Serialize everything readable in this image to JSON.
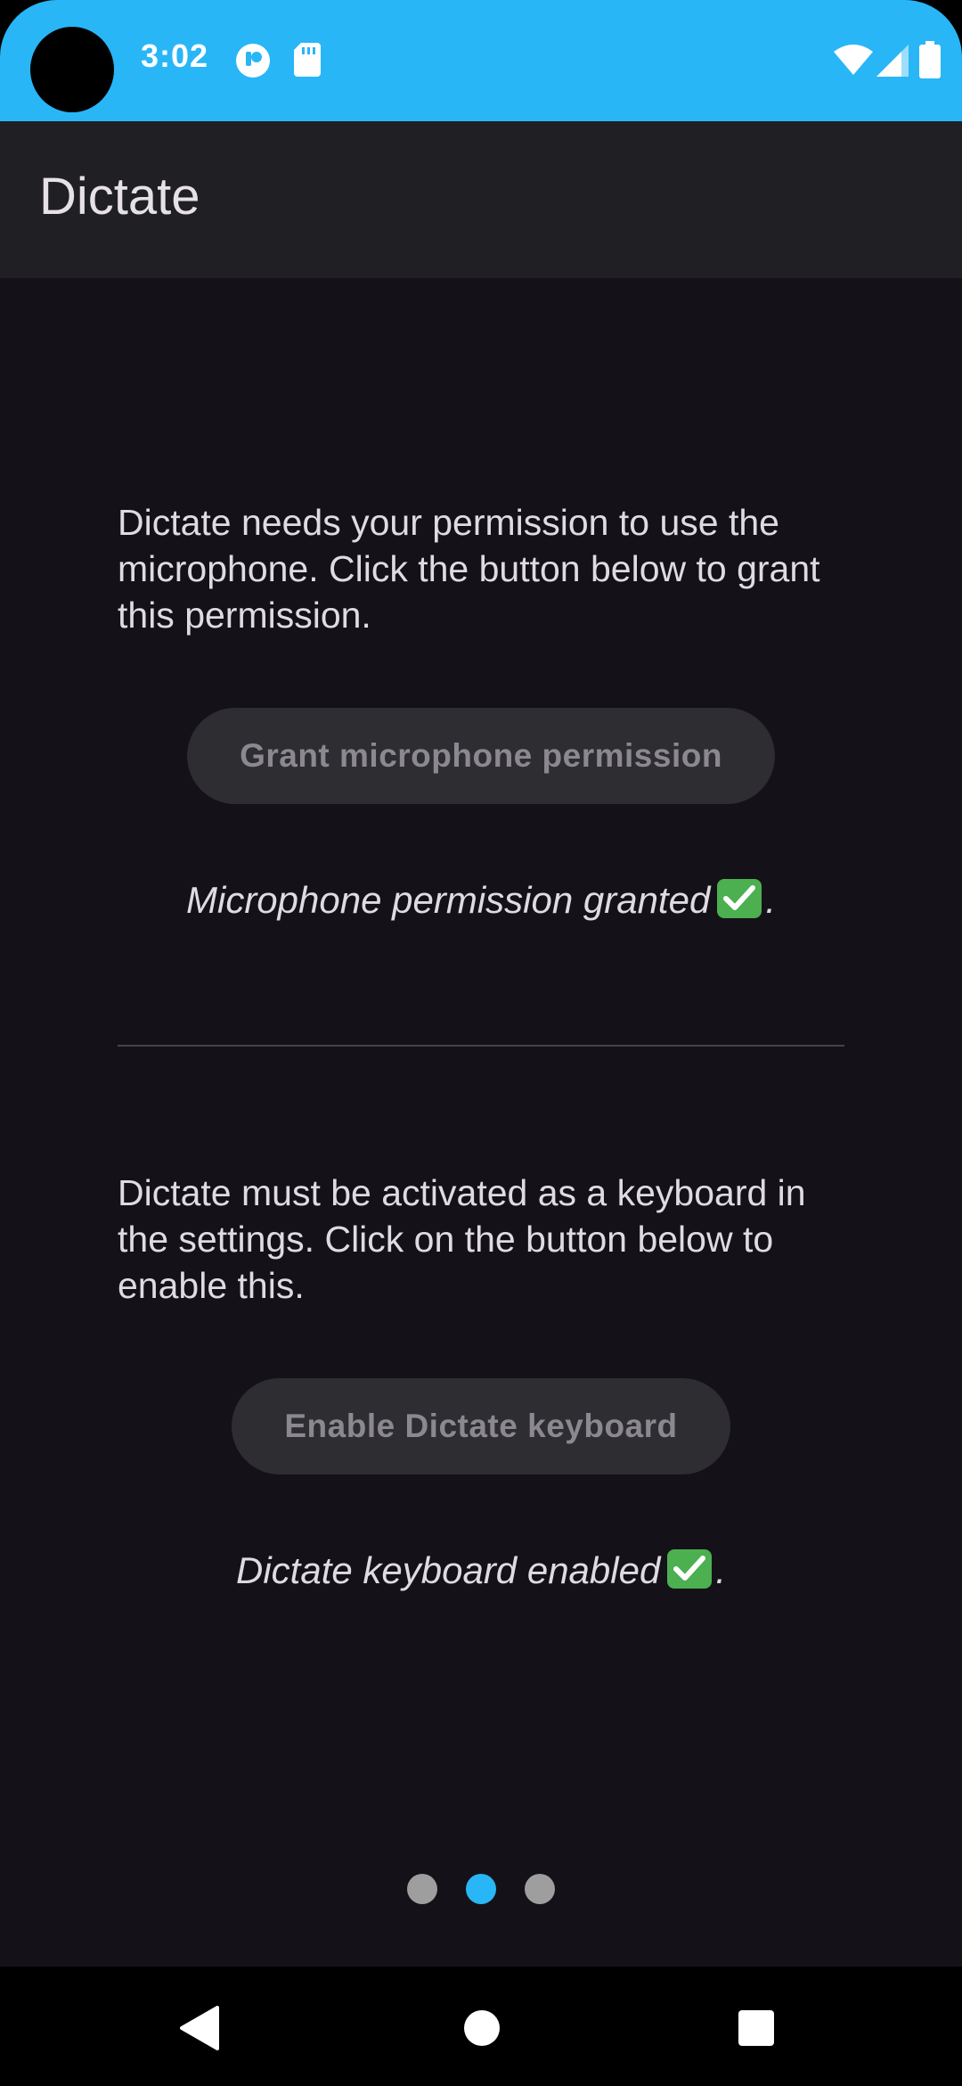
{
  "status_bar": {
    "time": "3:02",
    "icons": [
      "camera-cutout",
      "notification-app-icon",
      "sd-card-icon",
      "wifi-icon",
      "signal-icon",
      "battery-icon"
    ],
    "background_color": "#29b6f6"
  },
  "app_bar": {
    "title": "Dictate"
  },
  "microphone_section": {
    "description": "Dictate needs your permission to use the microphone. Click the button below to grant this permission.",
    "button_label": "Grant microphone permission",
    "status_text": "Microphone permission granted",
    "status_suffix": "."
  },
  "keyboard_section": {
    "description": "Dictate must be activated as a keyboard in the settings. Click on the button below to enable this.",
    "button_label": "Enable Dictate keyboard",
    "status_text": "Dictate keyboard enabled",
    "status_suffix": "."
  },
  "pager": {
    "pages": 3,
    "active_index": 1,
    "active_color": "#29b6f6",
    "inactive_color": "#9e9e9e"
  },
  "nav_bar": {
    "buttons": [
      "back-icon",
      "home-icon",
      "recents-icon"
    ]
  }
}
